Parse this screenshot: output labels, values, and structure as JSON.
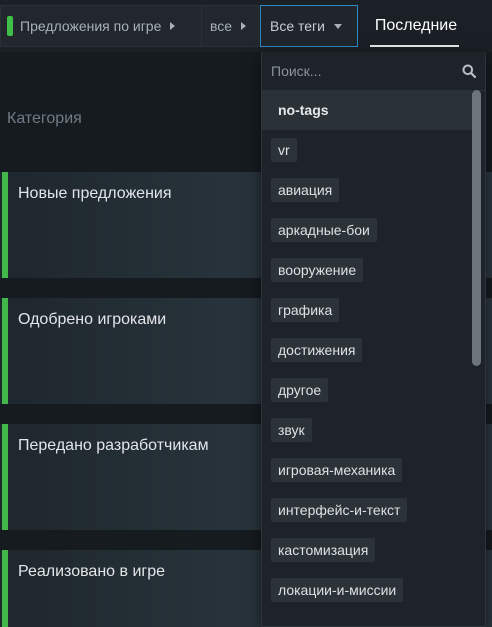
{
  "nav": {
    "breadcrumb_category": "Предложения по игре",
    "category_color": "#3fbf48",
    "breadcrumb_all": "все",
    "tags_dropdown_label": "Все теги",
    "tab_latest": "Последние"
  },
  "categories": {
    "header": "Категория",
    "items": [
      {
        "name": "Новые предложения",
        "color": "#43b84a"
      },
      {
        "name": "Одобрено игроками",
        "color": "#43b84a"
      },
      {
        "name": "Передано разработчикам",
        "color": "#43b84a"
      },
      {
        "name": "Реализовано в игре",
        "color": "#43b84a"
      }
    ]
  },
  "dropdown": {
    "search_placeholder": "Поиск...",
    "search_value": "",
    "tags": [
      "no-tags",
      "vr",
      "авиация",
      "аркадные-бои",
      "вооружение",
      "графика",
      "достижения",
      "другое",
      "звук",
      "игровая-механика",
      "интерфейс-и-текст",
      "кастомизация",
      "локации-и-миссии"
    ],
    "selected_tag": "no-tags"
  },
  "colors": {
    "accent_border": "#2b89c6",
    "page_background": "#161b20"
  }
}
